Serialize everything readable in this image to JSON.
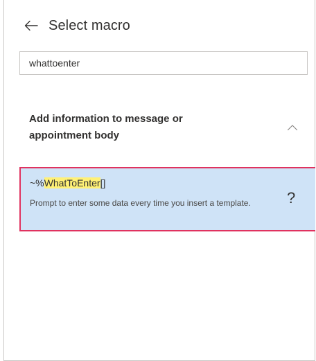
{
  "header": {
    "back_icon": "arrow-left-icon",
    "title": "Select macro"
  },
  "search": {
    "value": "whattoenter",
    "placeholder": ""
  },
  "group": {
    "title": "Add information to message or appointment body",
    "chevron_icon": "chevron-up-icon",
    "expanded": true
  },
  "macro": {
    "prefix": "~%",
    "highlight": "WhatToEnter",
    "suffix": "[]",
    "description": "Prompt to enter some data every time you insert a template.",
    "help_glyph": "?",
    "selected": true
  },
  "colors": {
    "selected_background": "#cfe3f7",
    "selected_border": "#e0325f",
    "match_highlight": "#fff176"
  }
}
